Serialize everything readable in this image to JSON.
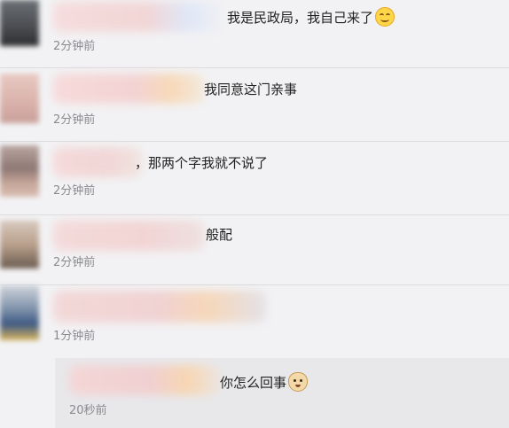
{
  "comments": [
    {
      "text": "我是民政局，我自己来了",
      "time": "2分钟前",
      "emoji": "smile-emoji"
    },
    {
      "text": "我同意这门亲事",
      "time": "2分钟前"
    },
    {
      "text": "，那两个字我就不说了",
      "time": "2分钟前"
    },
    {
      "text": "般配",
      "time": "2分钟前"
    },
    {
      "text": "",
      "time": "1分钟前"
    }
  ],
  "reply": {
    "text": "你怎么回事",
    "time": "20秒前",
    "emoji": "doge-emoji"
  }
}
